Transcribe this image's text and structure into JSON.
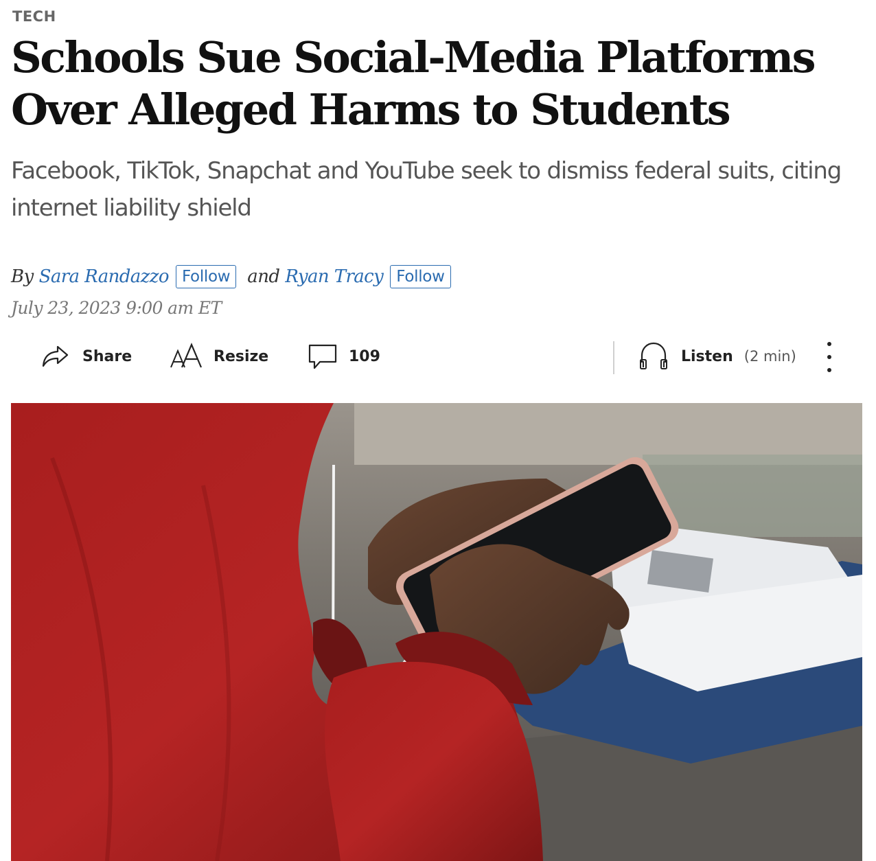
{
  "section": {
    "label": "TECH"
  },
  "article": {
    "headline": "Schools Sue Social-Media Platforms Over Alleged Harms to Students",
    "dek": "Facebook, TikTok, Snapchat and YouTube seek to dismiss federal suits, citing internet liability shield",
    "byline": {
      "prefix": "By",
      "authors": [
        {
          "name": "Sara Randazzo",
          "follow_label": "Follow"
        },
        {
          "name": "Ryan Tracy",
          "follow_label": "Follow"
        }
      ],
      "conjunction": "and"
    },
    "timestamp": "July 23, 2023 9:00 am ET"
  },
  "toolbar": {
    "share": {
      "label": "Share",
      "icon": "share-arrow-icon"
    },
    "resize": {
      "label": "Resize",
      "icon": "text-resize-icon"
    },
    "comments": {
      "count": "109",
      "icon": "comment-bubble-icon"
    },
    "listen": {
      "label": "Listen",
      "duration": "(2 min)",
      "icon": "headphones-icon"
    },
    "more": {
      "icon": "more-vertical-icon"
    }
  },
  "colors": {
    "link": "#2a6bb0",
    "section": "#666666",
    "dek": "#555555"
  }
}
